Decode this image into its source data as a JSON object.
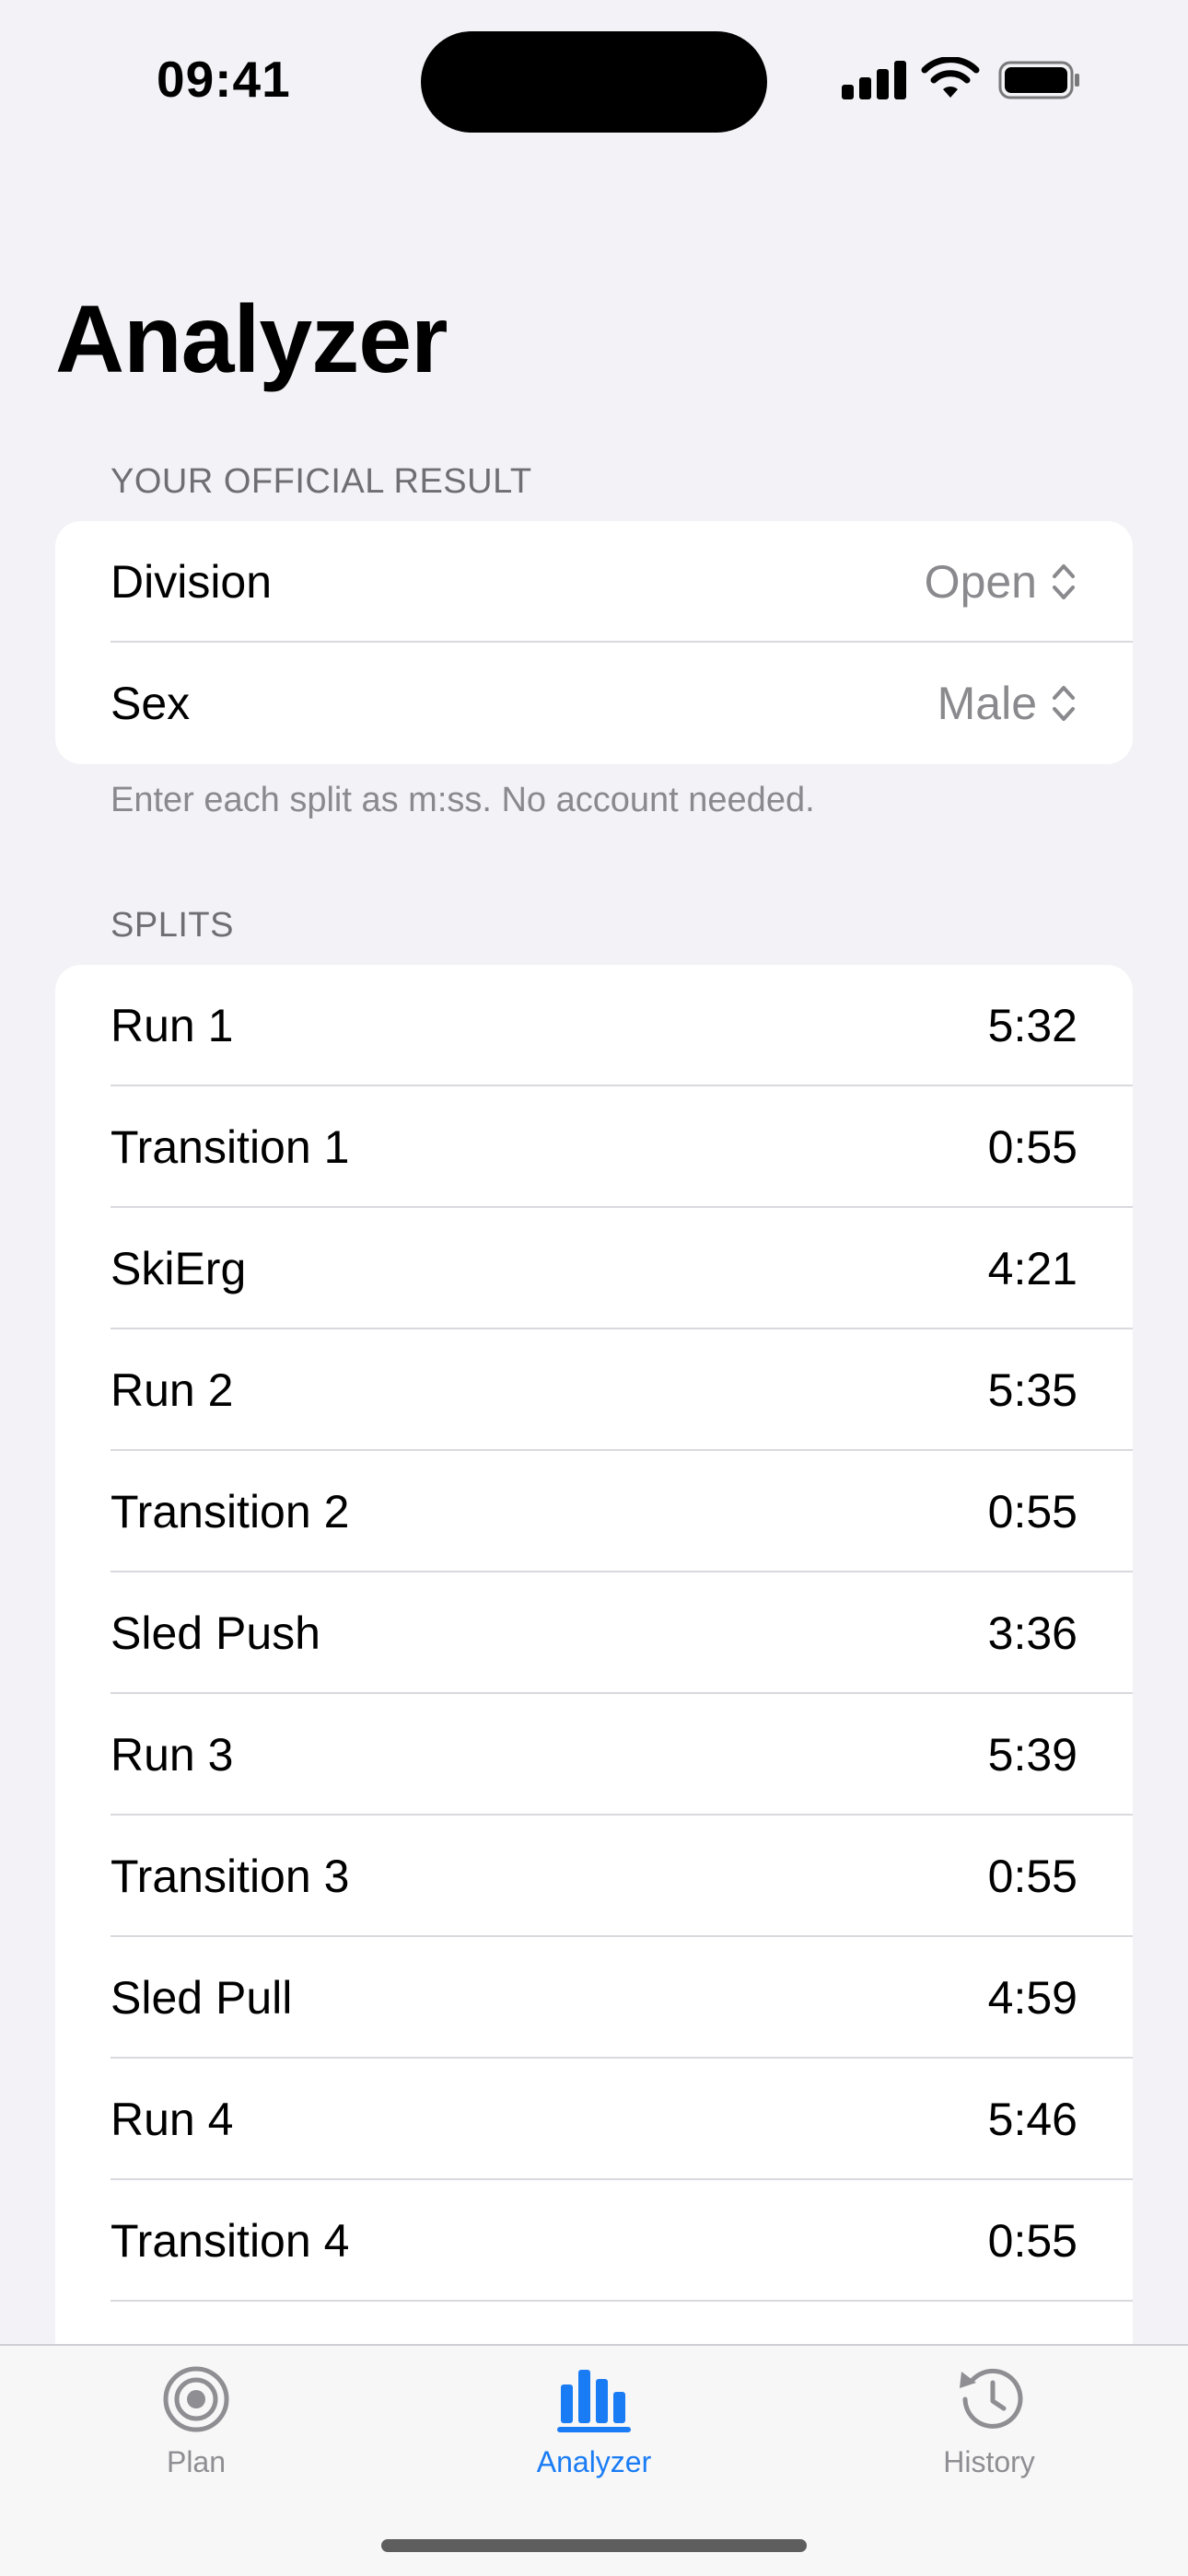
{
  "status_bar": {
    "time": "09:41"
  },
  "page_title": "Analyzer",
  "official_result": {
    "header": "YOUR OFFICIAL RESULT",
    "rows": [
      {
        "label": "Division",
        "value": "Open"
      },
      {
        "label": "Sex",
        "value": "Male"
      }
    ],
    "footnote": "Enter each split as m:ss. No account needed."
  },
  "splits": {
    "header": "SPLITS",
    "rows": [
      {
        "label": "Run 1",
        "value": "5:32"
      },
      {
        "label": "Transition 1",
        "value": "0:55"
      },
      {
        "label": "SkiErg",
        "value": "4:21"
      },
      {
        "label": "Run 2",
        "value": "5:35"
      },
      {
        "label": "Transition 2",
        "value": "0:55"
      },
      {
        "label": "Sled Push",
        "value": "3:36"
      },
      {
        "label": "Run 3",
        "value": "5:39"
      },
      {
        "label": "Transition 3",
        "value": "0:55"
      },
      {
        "label": "Sled Pull",
        "value": "4:59"
      },
      {
        "label": "Run 4",
        "value": "5:46"
      },
      {
        "label": "Transition 4",
        "value": "0:55"
      }
    ]
  },
  "tab_bar": {
    "tabs": [
      {
        "label": "Plan",
        "icon": "target-icon",
        "active": false
      },
      {
        "label": "Analyzer",
        "icon": "bar-chart-icon",
        "active": true
      },
      {
        "label": "History",
        "icon": "clock-history-icon",
        "active": false
      }
    ]
  },
  "colors": {
    "accent": "#1a7cf5",
    "background": "#f2f2f7",
    "secondary_text": "#8a8a8e"
  }
}
